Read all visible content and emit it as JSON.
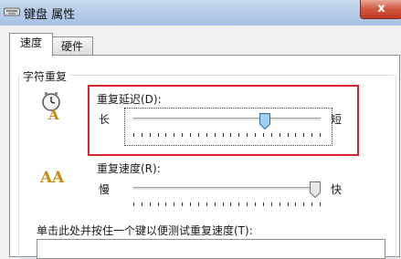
{
  "window": {
    "title": "键盘 属性",
    "close_label": "x"
  },
  "tabs": [
    {
      "label": "速度",
      "active": true
    },
    {
      "label": "硬件",
      "active": false
    }
  ],
  "group": {
    "title": "字符重复"
  },
  "repeat_delay": {
    "label": "重复延迟(D):",
    "min_label": "长",
    "max_label": "短",
    "value_fraction": 0.7
  },
  "repeat_rate": {
    "label": "重复速度(R):",
    "min_label": "慢",
    "max_label": "快",
    "value_fraction": 1.0
  },
  "test": {
    "label": "单击此处并按住一个键以便测试重复速度(T):",
    "value": ""
  },
  "colors": {
    "highlight": "#d6262b",
    "titlebar": "#b3c9e6",
    "thumb": "#9fd0f2"
  },
  "icons": {
    "delay_icon": "clock-a-icon",
    "rate_icon": "aa-icon",
    "title_icon": "keyboard-icon"
  }
}
